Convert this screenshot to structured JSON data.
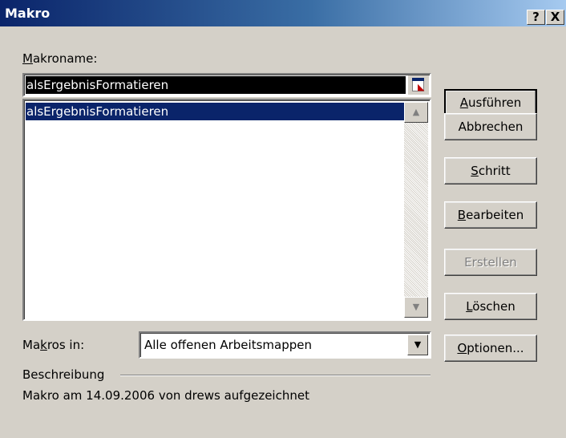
{
  "window": {
    "title": "Makro",
    "help_label": "?",
    "close_label": "X"
  },
  "macro_name": {
    "label": "Makroname:",
    "accesskey": "M",
    "label_rest": "akroname:",
    "value": "alsErgebnisFormatieren"
  },
  "macro_list": {
    "items": [
      "alsErgebnisFormatieren"
    ],
    "selected": "alsErgebnisFormatieren"
  },
  "buttons": {
    "run": {
      "label": "Ausführen",
      "accesskey": "A",
      "rest": "usführen"
    },
    "cancel": {
      "label": "Abbrechen"
    },
    "step": {
      "label": "Schritt",
      "accesskey": "S",
      "rest": "chritt"
    },
    "edit": {
      "label": "Bearbeiten",
      "accesskey": "B",
      "rest": "earbeiten"
    },
    "create": {
      "label": "Erstellen",
      "disabled": true
    },
    "delete": {
      "label": "Löschen",
      "accesskey": "L",
      "rest": "öschen"
    },
    "options": {
      "label": "Optionen...",
      "accesskey": "O",
      "rest": "ptionen..."
    }
  },
  "macros_in": {
    "label_pre": "Ma",
    "accesskey": "k",
    "label_post": "ros in:",
    "selected": "Alle offenen Arbeitsmappen"
  },
  "description": {
    "heading": "Beschreibung",
    "text": "Makro am 14.09.2006 von drews aufgezeichnet"
  }
}
